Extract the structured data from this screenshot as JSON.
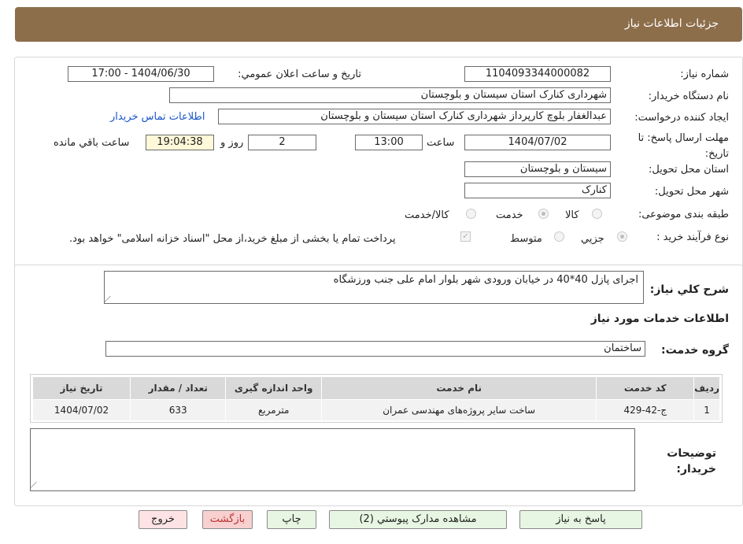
{
  "header": {
    "title": "جزئیات اطلاعات نیاز"
  },
  "fields": {
    "need_number_label": "شماره نیاز:",
    "need_number": "1104093344000082",
    "announce_label": "تاریخ و ساعت اعلان عمومي:",
    "announce_value": "1404/06/30 - 17:00",
    "buyer_org_label": "نام دستگاه خریدار:",
    "buyer_org": "شهرداری کنارک استان سیستان و بلوچستان",
    "creator_label": "ایجاد کننده درخواست:",
    "creator": "عبدالغفار بلوچ کارپرداز شهرداری کنارک استان سیستان و بلوچستان",
    "buyer_contact_link": "اطلاعات تماس خریدار",
    "deadline_label": "مهلت ارسال پاسخ: تا تاریخ:",
    "deadline_date": "1404/07/02",
    "time_label": "ساعت",
    "deadline_time": "13:00",
    "days": "2",
    "days_label": "روز و",
    "remaining_time": "19:04:38",
    "remaining_label": "ساعت باقي مانده",
    "province_label": "استان محل تحویل:",
    "province": "سیستان و بلوچستان",
    "city_label": "شهر محل تحویل:",
    "city": "کنارک",
    "category_label": "طبقه بندی موضوعی:",
    "category_options": [
      "کالا",
      "خدمت",
      "کالا/خدمت"
    ],
    "process_label": "نوع فرآیند خرید :",
    "process_options": [
      "جزيي",
      "متوسط"
    ],
    "payment_note": "پرداخت تمام یا بخشی از مبلغ خرید،از محل \"اسناد خزانه اسلامی\" خواهد بود.",
    "description_label": "شرح کلي نیاز:",
    "description": "اجرای پازل 40*40 در خیابان ورودی شهر بلوار امام علی جنب ورزشگاه",
    "services_title": "اطلاعات خدمات مورد نیاز",
    "service_group_label": "گروه خدمت:",
    "service_group": "ساختمان",
    "buyer_notes_label": "توضیحات خریدار:"
  },
  "table": {
    "headers": [
      "ردیف",
      "کد خدمت",
      "نام خدمت",
      "واحد اندازه گیری",
      "تعداد / مقدار",
      "تاریخ نیاز"
    ],
    "rows": [
      [
        "1",
        "ج-42-429",
        "ساخت سایر پروژه‌های مهندسی عمران",
        "مترمربع",
        "633",
        "1404/07/02"
      ]
    ]
  },
  "buttons": {
    "reply": "پاسخ به نیاز",
    "attachments": "مشاهده مدارک پیوستي (2)",
    "print": "چاپ",
    "back": "بازگشت",
    "exit": "خروج"
  }
}
